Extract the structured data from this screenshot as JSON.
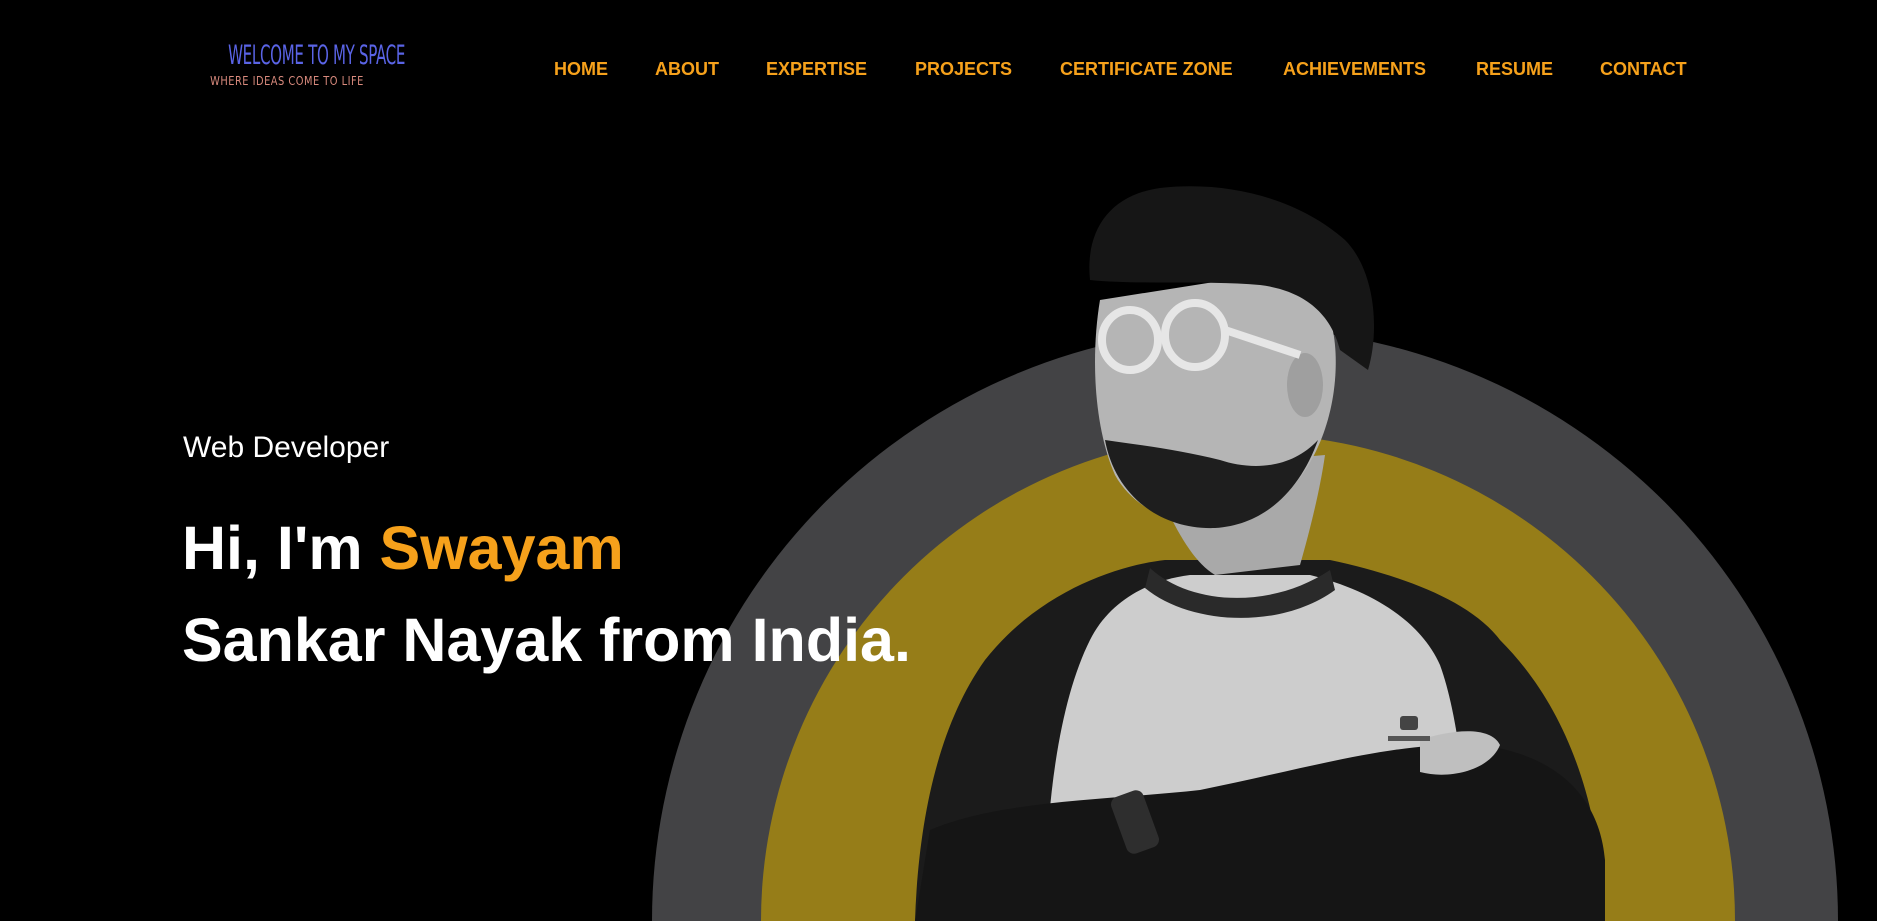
{
  "header": {
    "logo": {
      "title": "WELCOME TO MY SPACE",
      "tagline": "WHERE IDEAS COME TO LIFE"
    },
    "nav": [
      {
        "label": "HOME"
      },
      {
        "label": "ABOUT"
      },
      {
        "label": "EXPERTISE"
      },
      {
        "label": "PROJECTS"
      },
      {
        "label": "CERTIFICATE ZONE"
      },
      {
        "label": "ACHIEVEMENTS"
      },
      {
        "label": "RESUME"
      },
      {
        "label": "CONTACT"
      }
    ]
  },
  "hero": {
    "role": "Web Developer",
    "greeting": "Hi, I'm ",
    "first_name": "Swayam",
    "rest": "Sankar Nayak from India."
  },
  "colors": {
    "background": "#000000",
    "accent": "#f6a11b",
    "logo_title": "#5a64e6",
    "logo_tagline": "#d98a7d",
    "outer_arc": "#434345",
    "inner_arc": "#967d18",
    "text": "#ffffff"
  }
}
